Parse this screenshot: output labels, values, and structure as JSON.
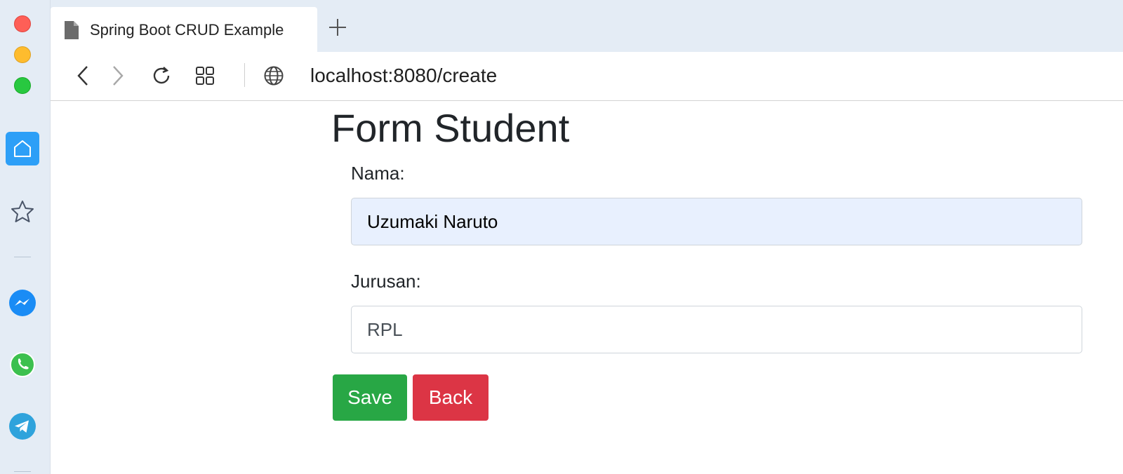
{
  "browser": {
    "tab_title": "Spring Boot CRUD Example",
    "new_tab_symbol": "+",
    "url": "localhost:8080/create",
    "icons": {
      "tab": "document-icon",
      "new_tab": "plus-icon",
      "back": "chevron-left-icon",
      "forward": "chevron-right-icon",
      "reload": "reload-icon",
      "grid": "grid-icon",
      "site": "globe-icon"
    }
  },
  "sidebar": {
    "items": [
      {
        "name": "home",
        "icon": "home-icon",
        "active": true
      },
      {
        "name": "favorites",
        "icon": "star-icon"
      },
      {
        "name": "messenger",
        "icon": "messenger-icon"
      },
      {
        "name": "whatsapp",
        "icon": "whatsapp-icon"
      },
      {
        "name": "telegram",
        "icon": "telegram-icon"
      }
    ],
    "colors": {
      "active": "#2d9ff7",
      "window_close": "#fe5f57",
      "window_minimize": "#febc2e",
      "window_maximize": "#28c840"
    }
  },
  "form": {
    "title": "Form Student",
    "nama_label": "Nama:",
    "nama_value": "Uzumaki Naruto",
    "jurusan_label": "Jurusan:",
    "jurusan_value": "RPL",
    "save_label": "Save",
    "back_label": "Back",
    "colors": {
      "save": "#28a745",
      "back": "#dc3545",
      "autofill": "#e8f0fe"
    }
  }
}
